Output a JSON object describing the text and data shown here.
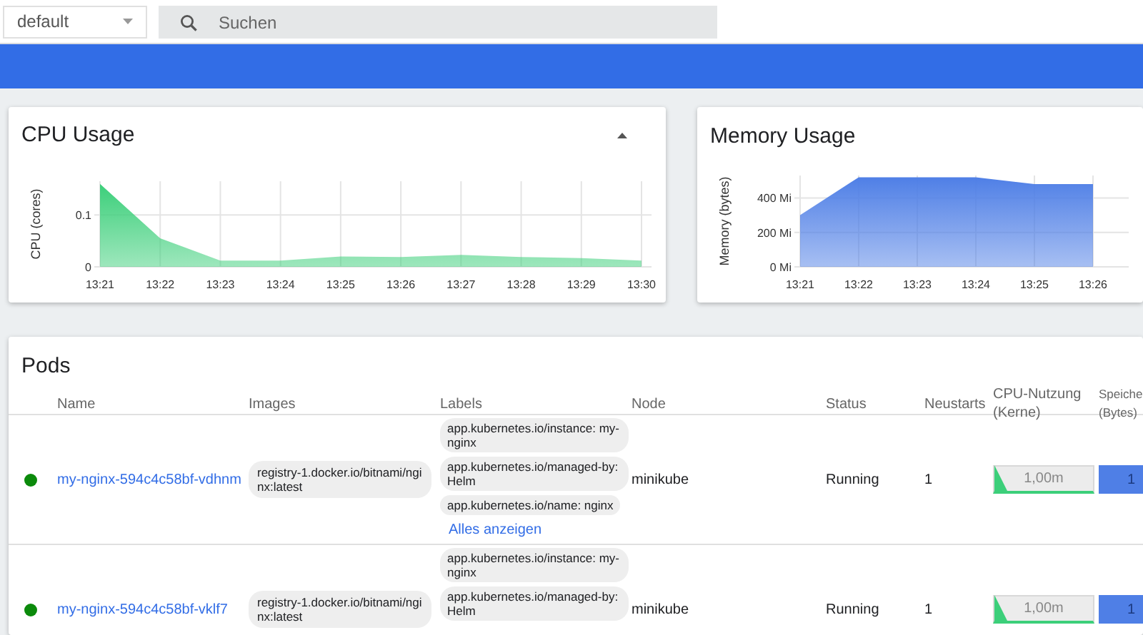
{
  "namespace_select": {
    "value": "default"
  },
  "search": {
    "placeholder": "Suchen"
  },
  "cpu_card": {
    "title": "CPU Usage",
    "chart_data": {
      "type": "area",
      "ylabel": "CPU (cores)",
      "categories": [
        "13:21",
        "13:22",
        "13:23",
        "13:24",
        "13:25",
        "13:26",
        "13:27",
        "13:28",
        "13:29",
        "13:30"
      ],
      "series": [
        {
          "color": "#3ccf7a",
          "values": [
            0.16,
            0.055,
            0.012,
            0.012,
            0.02,
            0.019,
            0.023,
            0.019,
            0.017,
            0.012
          ]
        }
      ],
      "ylim": [
        0,
        0.165
      ],
      "yticks": [
        0,
        0.1
      ],
      "grid": true
    }
  },
  "memory_card": {
    "title": "Memory Usage",
    "chart_data": {
      "type": "area",
      "ylabel": "Memory (bytes)",
      "categories": [
        "13:21",
        "13:22",
        "13:23",
        "13:24",
        "13:25",
        "13:26"
      ],
      "series": [
        {
          "color": "#4f7fe6",
          "values": [
            300,
            520,
            520,
            520,
            480,
            480
          ]
        }
      ],
      "ylim": [
        0,
        530
      ],
      "yticks": [
        {
          "value": 0,
          "label": "0 Mi"
        },
        {
          "value": 200,
          "label": "200 Mi"
        },
        {
          "value": 400,
          "label": "400 Mi"
        }
      ],
      "grid": true
    }
  },
  "pods": {
    "title": "Pods",
    "columns": [
      "Name",
      "Images",
      "Labels",
      "Node",
      "Status",
      "Neustarts",
      "CPU-Nutzung (Kerne)",
      "Speiche (Bytes)"
    ],
    "rows": [
      {
        "color": "#0b8a0b",
        "name": "my-nginx-594c4c58bf-vdhnm",
        "image": "registry-1.docker.io/bitnami/nginx:latest",
        "labels": [
          "app.kubernetes.io/instance: my-nginx",
          "app.kubernetes.io/managed-by: Helm",
          "app.kubernetes.io/name: nginx"
        ],
        "show_all": "Alles anzeigen",
        "node": "minikube",
        "status": "Running",
        "restarts": "1",
        "cpu": "1,00m",
        "memory": "1"
      },
      {
        "color": "#0b8a0b",
        "name": "my-nginx-594c4c58bf-vklf7",
        "image": "registry-1.docker.io/bitnami/nginx:latest",
        "labels": [
          "app.kubernetes.io/instance: my-nginx",
          "app.kubernetes.io/managed-by: Helm"
        ],
        "node": "minikube",
        "status": "Running",
        "restarts": "1",
        "cpu": "1,00m",
        "memory": "1"
      }
    ]
  }
}
